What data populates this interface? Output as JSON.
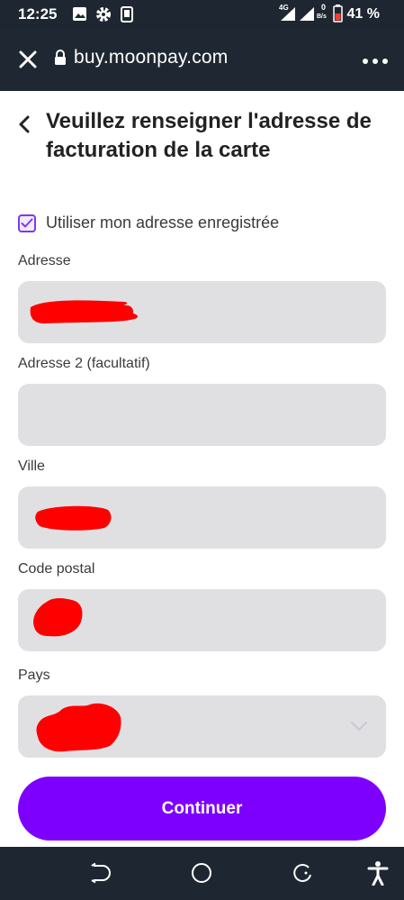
{
  "status_bar": {
    "time": "12:25",
    "network": "4G",
    "speed_value": "0",
    "speed_unit": "B/s",
    "battery": "41 %",
    "icons": [
      "gallery-icon",
      "gear-icon",
      "phone-icon",
      "signal-icon",
      "signal-icon",
      "battery-icon"
    ]
  },
  "browser": {
    "url": "buy.moonpay.com",
    "icons": [
      "close-icon",
      "lock-icon",
      "more-menu-icon"
    ]
  },
  "page": {
    "title": "Veuillez renseigner l'adresse de facturation de la carte",
    "use_saved_label": "Utiliser mon adresse enregistrée",
    "use_saved_checked": true
  },
  "form": {
    "address_label": "Adresse",
    "address2_label": "Adresse 2 (facultatif)",
    "city_label": "Ville",
    "postal_label": "Code postal",
    "country_label": "Pays"
  },
  "actions": {
    "continue_label": "Continuer"
  },
  "colors": {
    "accent": "#7d00ff",
    "field_bg": "#e0e0e3",
    "redaction": "#ff0000",
    "bars": "#1e2731"
  }
}
